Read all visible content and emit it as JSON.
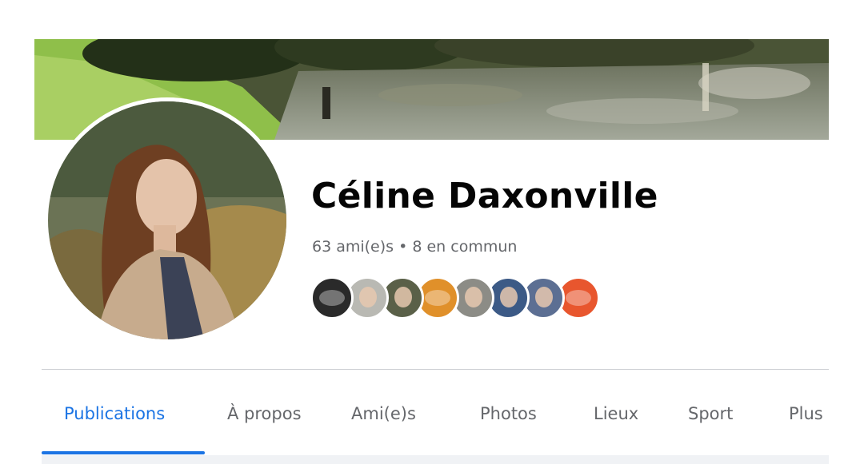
{
  "profile": {
    "name": "Céline Daxonville",
    "friends_summary": "63 ami(e)s • 8 en commun",
    "mutual_friend_avatars": [
      {
        "name": "friend-avatar-1",
        "color": "#2a2a2a"
      },
      {
        "name": "friend-avatar-2",
        "color": "#b9b9b3"
      },
      {
        "name": "friend-avatar-3",
        "color": "#5a6048"
      },
      {
        "name": "friend-avatar-4",
        "color": "#e0902a"
      },
      {
        "name": "friend-avatar-5",
        "color": "#8c8c86"
      },
      {
        "name": "friend-avatar-6",
        "color": "#3c5a86"
      },
      {
        "name": "friend-avatar-7",
        "color": "#5c6f93"
      },
      {
        "name": "friend-avatar-8",
        "color": "#e8562e"
      }
    ]
  },
  "tabs": [
    {
      "label": "Publications",
      "active": true
    },
    {
      "label": "À propos",
      "active": false
    },
    {
      "label": "Ami(e)s",
      "active": false
    },
    {
      "label": "Photos",
      "active": false
    },
    {
      "label": "Lieux",
      "active": false
    },
    {
      "label": "Sport",
      "active": false
    },
    {
      "label": "Plus",
      "active": false
    }
  ],
  "colors": {
    "accent": "#1b74e4",
    "text_primary": "#050505",
    "text_secondary": "#65676b"
  }
}
